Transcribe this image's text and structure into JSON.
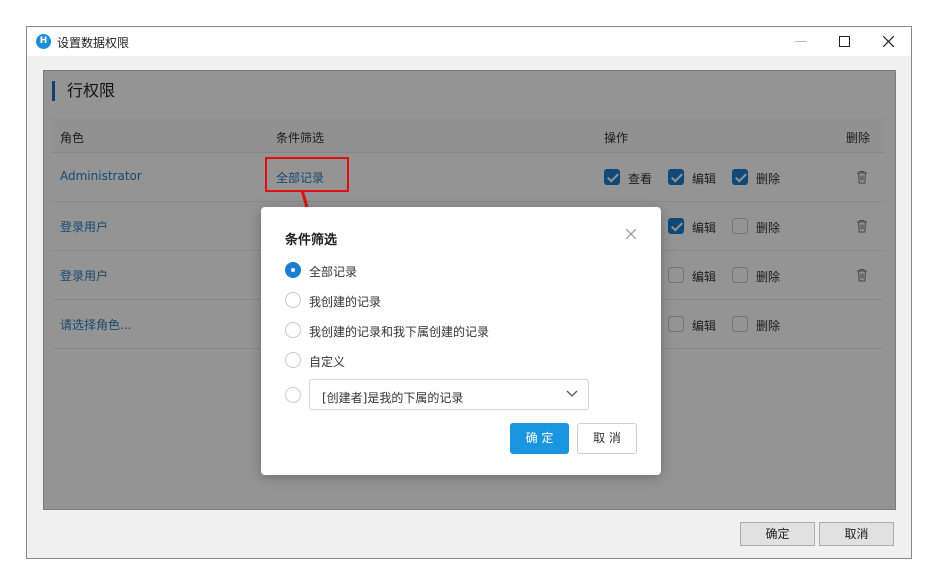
{
  "window": {
    "title": "设置数据权限",
    "app_icon_letter": "H"
  },
  "section": {
    "title": "行权限"
  },
  "table": {
    "headers": {
      "role": "角色",
      "condition": "条件筛选",
      "actions": "操作",
      "delete": "删除"
    },
    "rows": [
      {
        "role": "Administrator",
        "condition": "全部记录",
        "view_label": "查看",
        "view_checked": true,
        "edit_label": "编辑",
        "edit_checked": true,
        "del_label": "删除",
        "del_checked": true
      },
      {
        "role": "登录用户",
        "edit_label": "编辑",
        "edit_checked": true,
        "del_label": "删除",
        "del_checked": false
      },
      {
        "role": "登录用户",
        "edit_label": "编辑",
        "edit_checked": false,
        "del_label": "删除",
        "del_checked": false
      },
      {
        "role": "请选择角色...",
        "edit_label": "编辑",
        "edit_checked": false,
        "del_label": "删除",
        "del_checked": false
      }
    ]
  },
  "footer": {
    "ok_label": "确定",
    "cancel_label": "取消"
  },
  "dialog": {
    "title": "条件筛选",
    "options": [
      {
        "label": "全部记录",
        "selected": true
      },
      {
        "label": "我创建的记录",
        "selected": false
      },
      {
        "label": "我创建的记录和我下属创建的记录",
        "selected": false
      },
      {
        "label": "自定义",
        "selected": false
      }
    ],
    "select_value": "[创建者]是我的下属的记录",
    "ok_label": "确 定",
    "cancel_label": "取 消"
  },
  "colors": {
    "accent": "#1a96e0",
    "link": "#2d7fc1",
    "highlight": "#e01010"
  }
}
